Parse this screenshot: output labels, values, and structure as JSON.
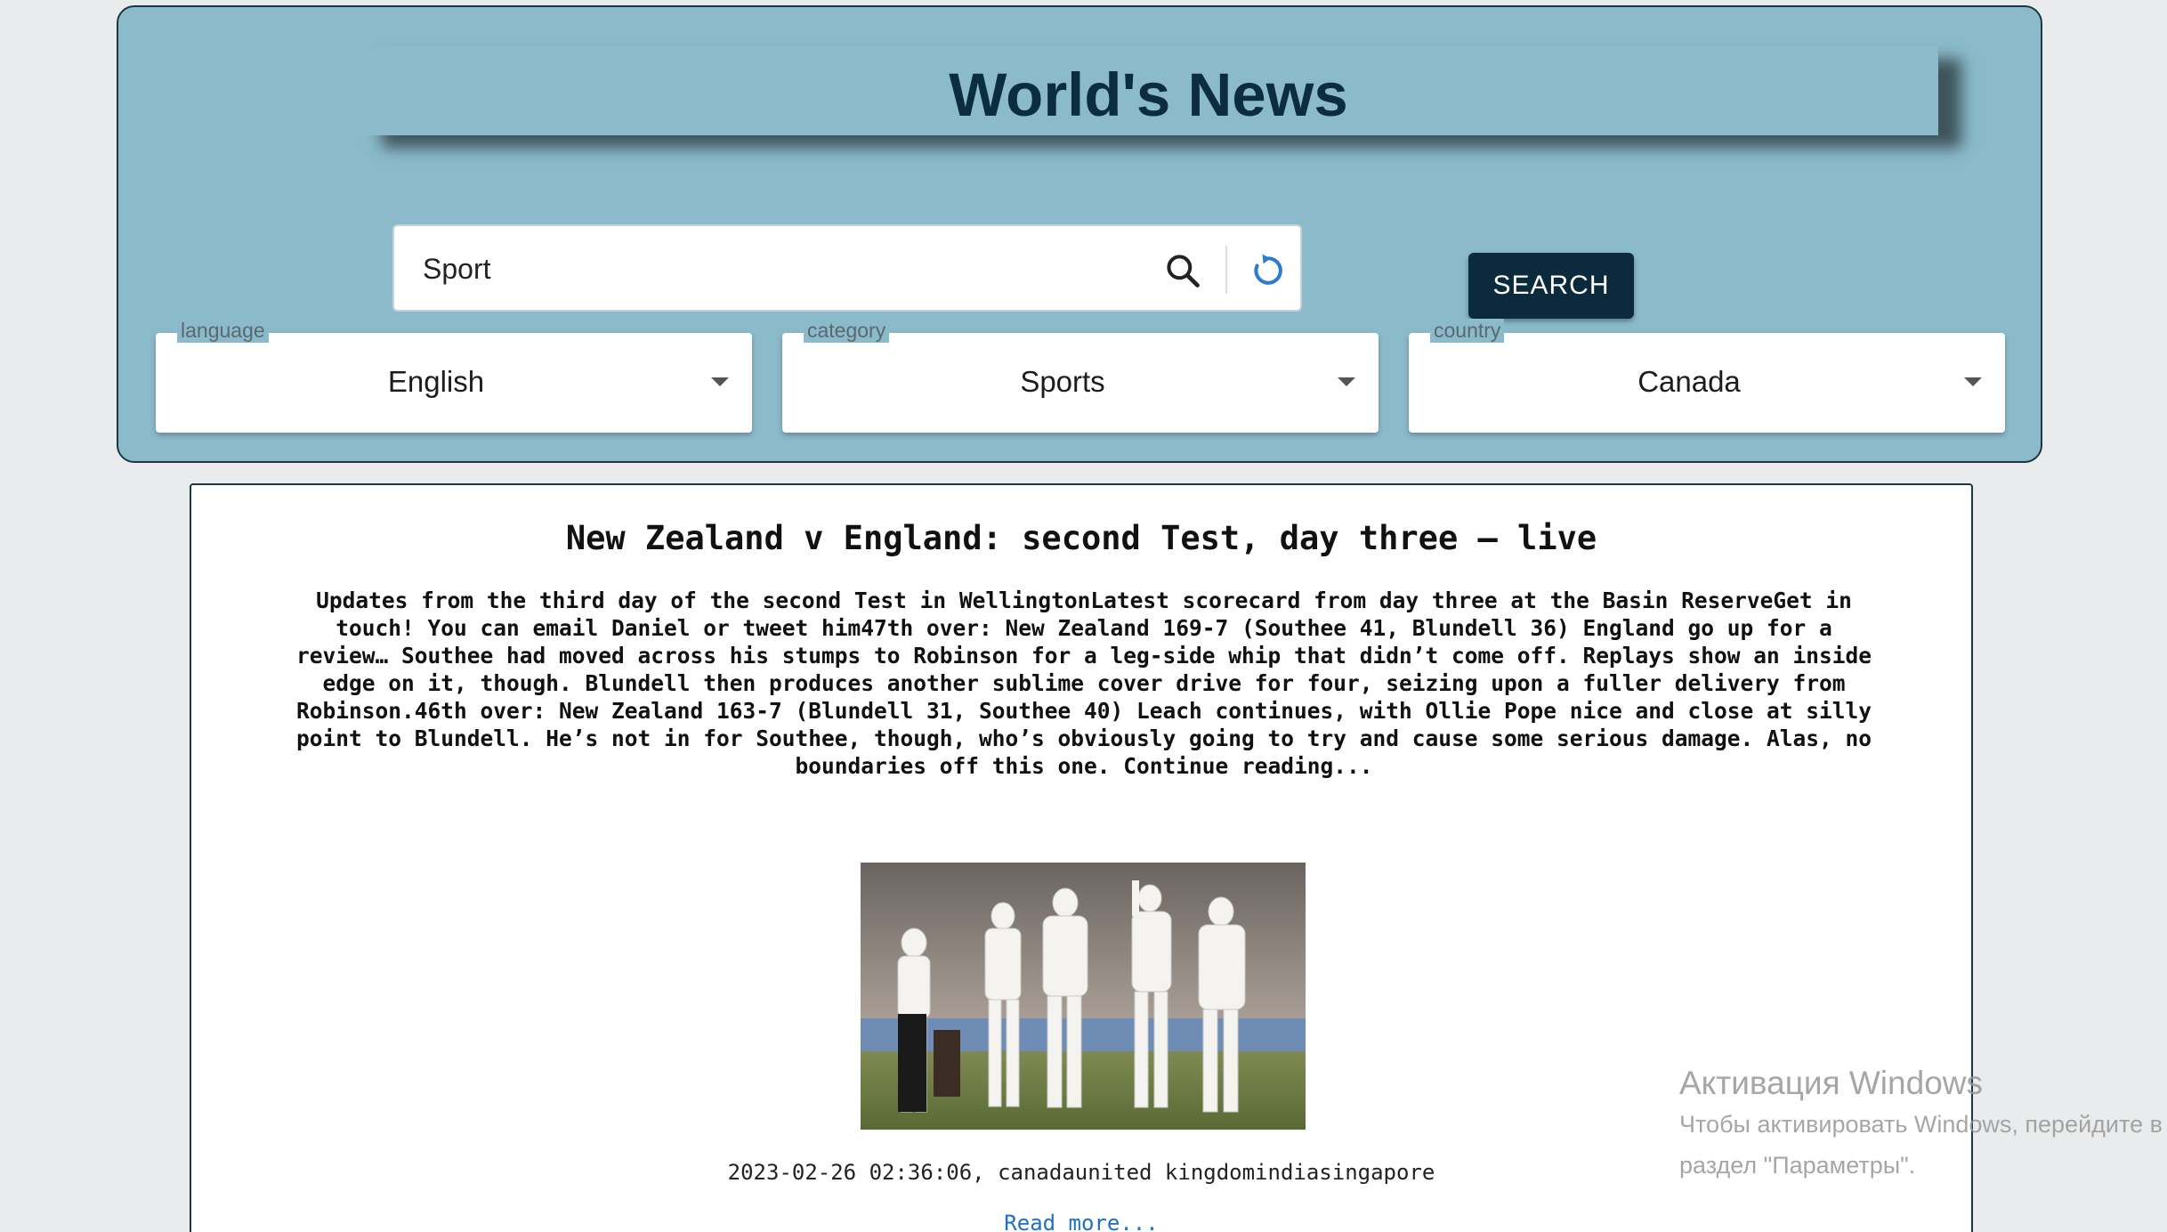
{
  "header": {
    "title": "World's News"
  },
  "search": {
    "value": "Sport",
    "button_label": "SEARCH"
  },
  "filters": [
    {
      "label": "language",
      "value": "English"
    },
    {
      "label": "category",
      "value": "Sports"
    },
    {
      "label": "country",
      "value": "Canada"
    }
  ],
  "article": {
    "title": "New Zealand v England: second Test, day three – live",
    "body": "Updates from the third day of the second Test in WellingtonLatest scorecard from day three at the Basin ReserveGet in touch! You can email Daniel or tweet him47th over: New Zealand 169-7 (Southee 41, Blundell 36) England go up for a review… Southee had moved across his stumps to Robinson for a leg-side whip that didn’t come off. Replays show an inside edge on it, though. Blundell then produces another sublime cover drive for four, seizing upon a fuller delivery from Robinson.46th over: New Zealand 163-7 (Blundell 31, Southee 40) Leach continues, with Ollie Pope nice and close at silly point to Blundell. He’s not in for Southee, though, who’s obviously going to try and cause some serious damage. Alas, no boundaries off this one. Continue reading...",
    "meta": "2023-02-26 02:36:06, canadaunited kingdomindiasingapore",
    "read_more": "Read more..."
  },
  "watermark": {
    "title": "Активация Windows",
    "line1": "Чтобы активировать Windows, перейдите в",
    "line2": "раздел \"Параметры\"."
  },
  "colors": {
    "header_bg": "#8bbbcb",
    "accent_dark": "#0b2b3c",
    "link": "#1f6fc6"
  }
}
